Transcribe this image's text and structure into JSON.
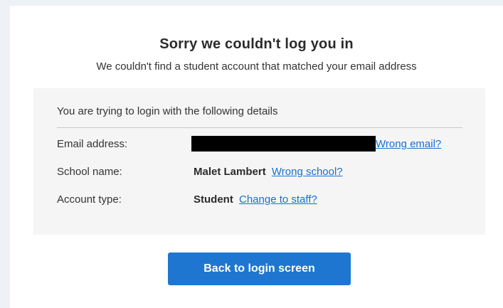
{
  "page": {
    "title": "Sorry we couldn't log you in",
    "subtitle": "We couldn't find a student account that matched your email address"
  },
  "details": {
    "heading": "You are trying to login with the following details",
    "rows": [
      {
        "label": "Email address:",
        "value": "",
        "value_redacted": true,
        "link_label": "Wrong email?"
      },
      {
        "label": "School name:",
        "value": "Malet Lambert",
        "link_label": "Wrong school?"
      },
      {
        "label": "Account type:",
        "value": "Student",
        "link_label": "Change to staff?"
      }
    ]
  },
  "actions": {
    "back_label": "Back to login screen"
  },
  "colors": {
    "primary_button": "#1e76d0",
    "link": "#1a6fcf",
    "panel_background": "#f5f5f5",
    "redaction": "#000000"
  }
}
